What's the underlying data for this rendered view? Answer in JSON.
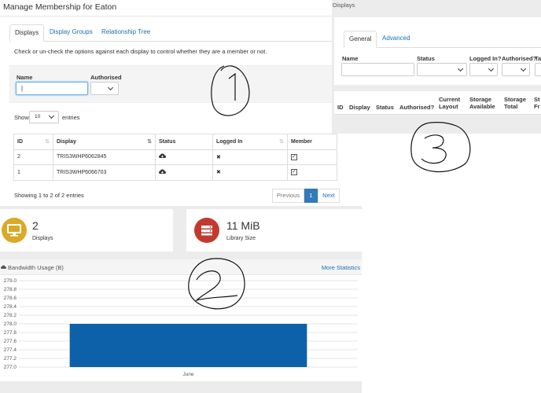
{
  "membership": {
    "title": "Manage Membership for Eaton",
    "tabs": [
      "Displays",
      "Display Groups",
      "Relationship Tree"
    ],
    "hint": "Check or un-check the options against each display to control whether they are a member or not.",
    "filter": {
      "name_label": "Name",
      "name_value": "|",
      "authorised_label": "Authorised"
    },
    "show": {
      "prefix": "Show",
      "value": "10",
      "suffix": "entries"
    },
    "columns": [
      "ID",
      "Display",
      "Status",
      "Logged In",
      "Member"
    ],
    "rows": [
      {
        "id": "2",
        "display": "TRIS3WHP6062845",
        "status": "cloud-download-icon",
        "logged_in": "✖",
        "member": "checked"
      },
      {
        "id": "1",
        "display": "TRIS3WHP6066703",
        "status": "cloud-download-icon",
        "logged_in": "✖",
        "member": "checked"
      }
    ],
    "paging_text": "Showing 1 to 2 of 2 entries",
    "pager": {
      "previous": "Previous",
      "current": "1",
      "next": "Next"
    }
  },
  "displays_panel": {
    "title": "Displays",
    "tabs": [
      "General",
      "Advanced"
    ],
    "filters": [
      "Name",
      "Status",
      "Logged In?",
      "Authorised?",
      "Ta"
    ],
    "columns": [
      "ID",
      "Display",
      "Status",
      "Authorised?",
      "Current Layout",
      "Storage Available",
      "Storage Total",
      "St Fr"
    ]
  },
  "stats": {
    "displays_count": "2",
    "displays_label": "Displays",
    "library_size": "11 MiB",
    "library_label": "Library Size"
  },
  "bandwidth": {
    "title": "Bandwidth Usage (B)",
    "more_link": "More Statistics"
  },
  "chart_data": {
    "type": "bar",
    "categories": [
      "June"
    ],
    "values": [
      278.0
    ],
    "ylim": [
      277.0,
      279.0
    ],
    "yticks": [
      "279.0",
      "278.8",
      "278.6",
      "278.4",
      "278.2",
      "278.0",
      "277.8",
      "277.6",
      "277.4",
      "277.2",
      "277.0"
    ],
    "bar_color": "#0c61a8",
    "grid": true
  },
  "colors": {
    "link": "#1a6fb5",
    "displays_icon_bg": "#d9a928",
    "library_icon_bg": "#c23a2e",
    "active_page": "#337ab7"
  }
}
